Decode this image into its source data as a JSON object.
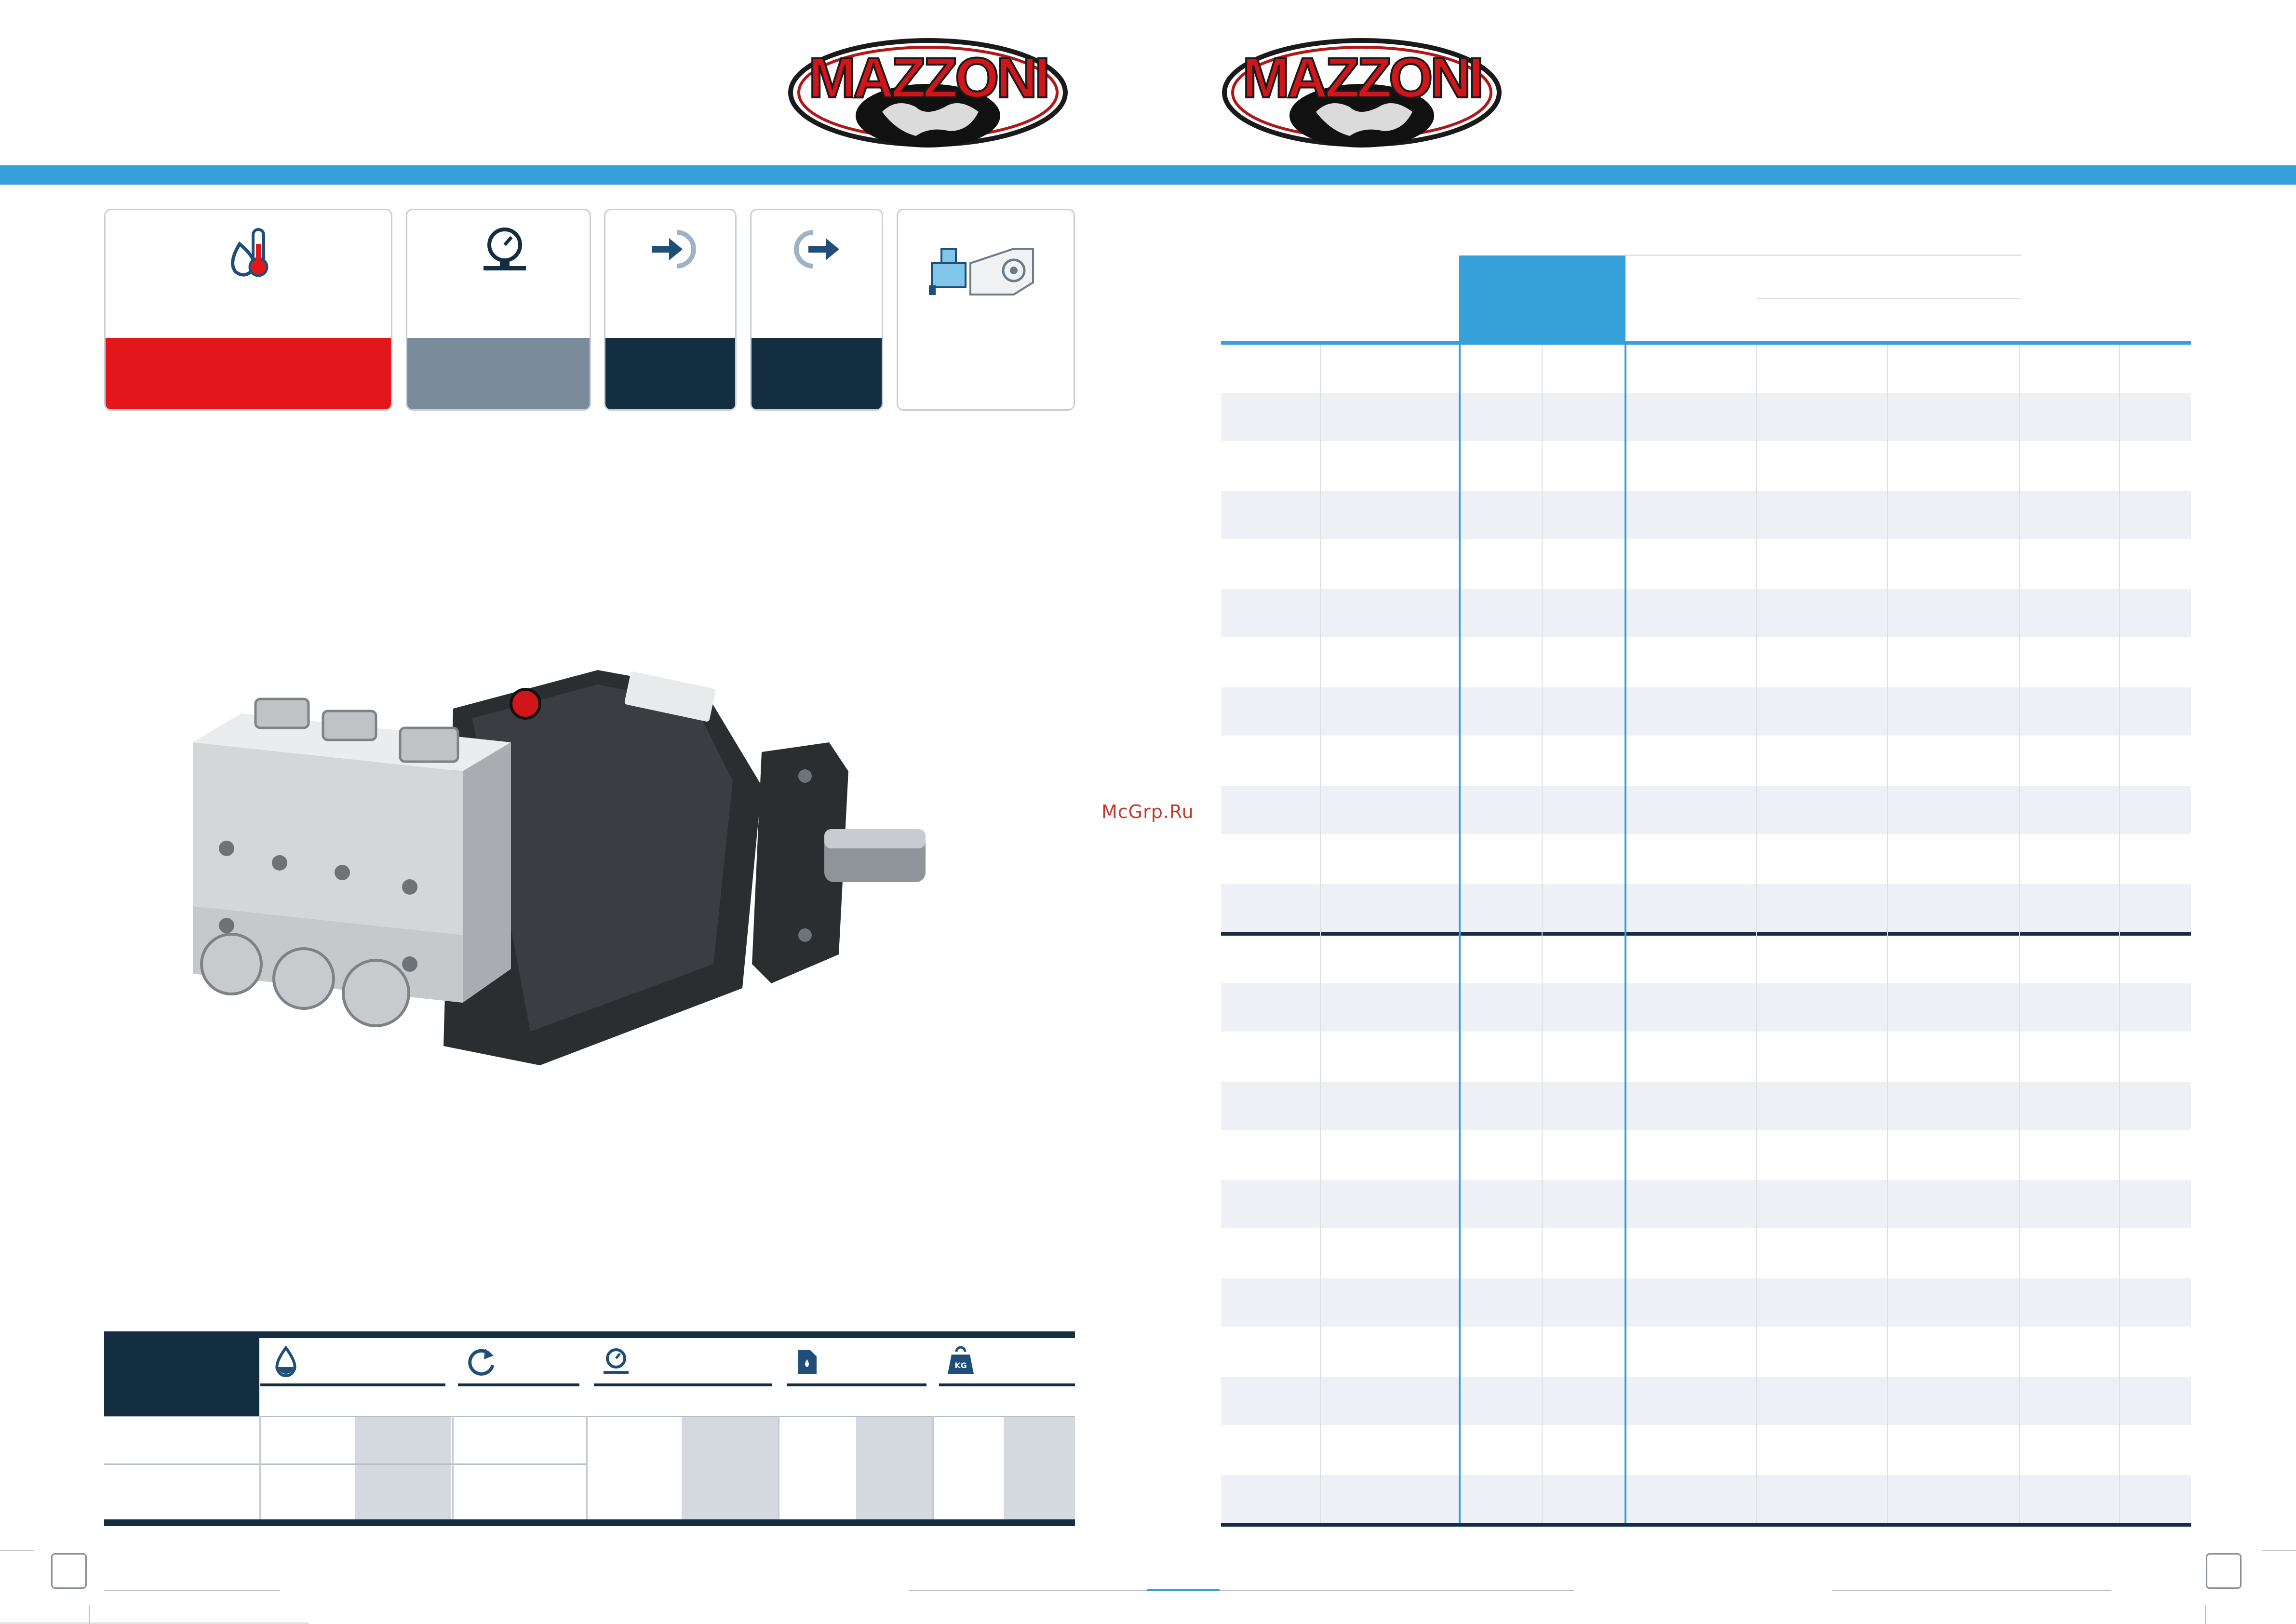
{
  "header": {
    "logos": [
      {
        "wordmark": "MAZZONI"
      },
      {
        "wordmark": "MAZZONI"
      }
    ]
  },
  "feature_cards": [
    {
      "icon": "temperature-droplet-icon",
      "bottom_color": "#e2161b"
    },
    {
      "icon": "pressure-gauge-icon",
      "bottom_color": "#7a8c9b"
    },
    {
      "icon": "arrow-in-icon",
      "bottom_color": "#132e40"
    },
    {
      "icon": "arrow-out-icon",
      "bottom_color": "#132e40"
    },
    {
      "icon": "pump-gearbox-icon",
      "bottom_color": "#ffffff"
    }
  ],
  "watermark": "McGrp.Ru",
  "spec_table_icons": [
    "flow-droplet-icon",
    "rotation-icon",
    "pressure-gauge-icon",
    "oil-can-icon",
    "weight-kg-icon"
  ],
  "weight_icon_label": "KG",
  "colors": {
    "accent_blue": "#36a0d8",
    "navy": "#132e40",
    "red": "#e2161b",
    "steel": "#7a8c9b"
  }
}
